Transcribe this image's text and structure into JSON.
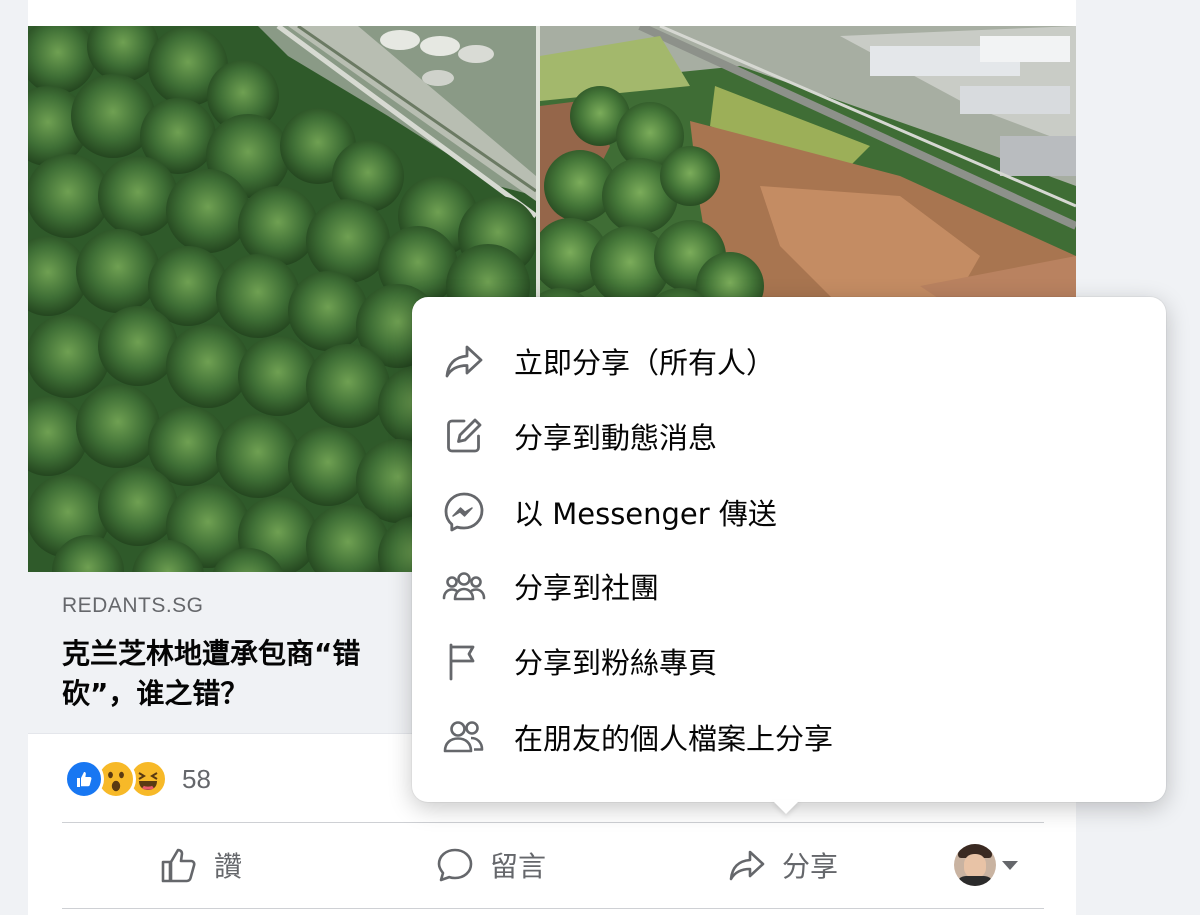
{
  "post": {
    "link_domain": "REDANTS.SG",
    "link_title": "克兰芝林地遭承包商“错砍”，谁之错？",
    "reaction_count": "58",
    "reactions": [
      "like",
      "wow",
      "haha"
    ],
    "actions": {
      "like_label": "讚",
      "comment_label": "留言",
      "share_label": "分享"
    }
  },
  "share_menu": {
    "items": [
      {
        "label": "立即分享（所有人）",
        "icon": "share-arrow-icon"
      },
      {
        "label": "分享到動態消息",
        "icon": "edit-pencil-icon"
      },
      {
        "label": "以 Messenger 傳送",
        "icon": "messenger-icon"
      },
      {
        "label": "分享到社團",
        "icon": "groups-icon"
      },
      {
        "label": "分享到粉絲專頁",
        "icon": "flag-icon"
      },
      {
        "label": "在朋友的個人檔案上分享",
        "icon": "friends-icon"
      }
    ]
  },
  "colors": {
    "like_blue": "#1877f2",
    "emoji_yellow": "#f7b928",
    "secondary_text": "#65676b",
    "primary_text": "#050505",
    "background": "#f0f2f5"
  }
}
